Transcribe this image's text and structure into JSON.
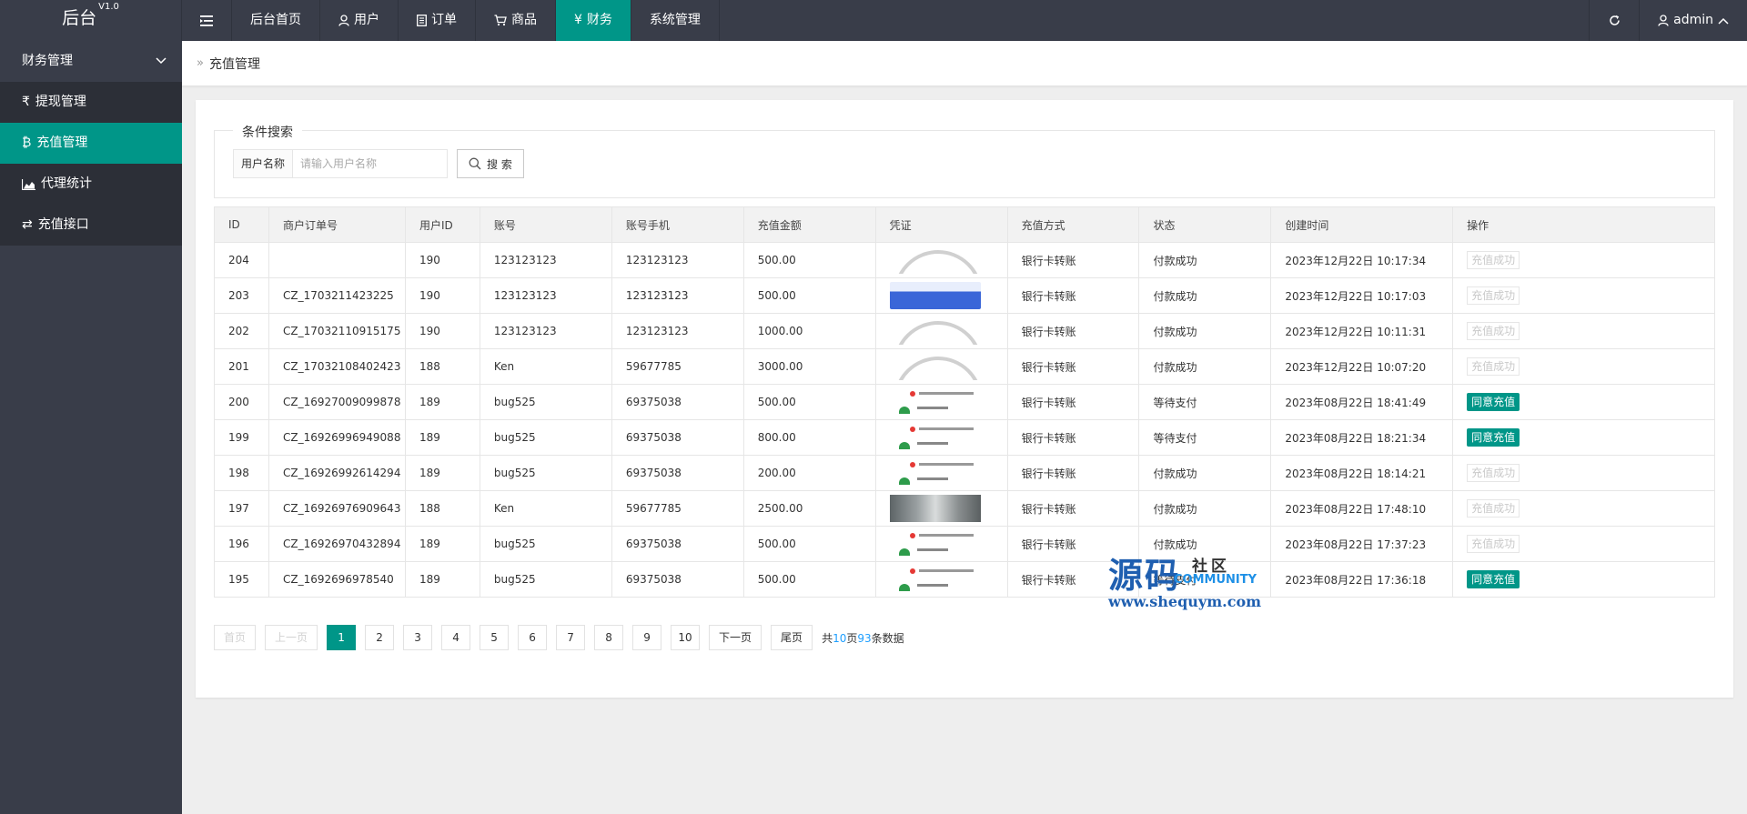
{
  "header": {
    "logo": "后台",
    "version": "V1.0",
    "nav": [
      {
        "label": "后台首页",
        "icon": ""
      },
      {
        "label": "用户",
        "icon": "user-icon"
      },
      {
        "label": "订单",
        "icon": "document-icon"
      },
      {
        "label": "商品",
        "icon": "cart-icon"
      },
      {
        "label": "财务",
        "icon": "yen-icon"
      },
      {
        "label": "系统管理",
        "icon": ""
      }
    ],
    "user": "admin"
  },
  "sidebar": {
    "group": "财务管理",
    "items": [
      {
        "label": "提现管理",
        "icon": "rupee-icon"
      },
      {
        "label": "充值管理",
        "icon": "bitcoin-icon"
      },
      {
        "label": "代理统计",
        "icon": "area-chart-icon"
      },
      {
        "label": "充值接口",
        "icon": "exchange-icon"
      }
    ]
  },
  "breadcrumb": "充值管理",
  "search": {
    "legend": "条件搜索",
    "label": "用户名称",
    "placeholder": "请输入用户名称",
    "button": "搜 索"
  },
  "table": {
    "headers": [
      "ID",
      "商户订单号",
      "用户ID",
      "账号",
      "账号手机",
      "充值金额",
      "凭证",
      "充值方式",
      "状态",
      "创建时间",
      "操作"
    ],
    "rows": [
      {
        "id": "204",
        "order": "",
        "uid": "190",
        "account": "123123123",
        "phone": "123123123",
        "amount": "500.00",
        "voucher": "arc",
        "method": "银行卡转账",
        "status": "付款成功",
        "status_type": "ok",
        "time": "2023年12月22日 10:17:34",
        "action": "充值成功",
        "action_type": "done"
      },
      {
        "id": "203",
        "order": "CZ_1703211423225",
        "uid": "190",
        "account": "123123123",
        "phone": "123123123",
        "amount": "500.00",
        "voucher": "blue",
        "method": "银行卡转账",
        "status": "付款成功",
        "status_type": "ok",
        "time": "2023年12月22日 10:17:03",
        "action": "充值成功",
        "action_type": "done"
      },
      {
        "id": "202",
        "order": "CZ_17032110915175",
        "uid": "190",
        "account": "123123123",
        "phone": "123123123",
        "amount": "1000.00",
        "voucher": "arc",
        "method": "银行卡转账",
        "status": "付款成功",
        "status_type": "ok",
        "time": "2023年12月22日 10:11:31",
        "action": "充值成功",
        "action_type": "done"
      },
      {
        "id": "201",
        "order": "CZ_17032108402423",
        "uid": "188",
        "account": "Ken",
        "phone": "59677785",
        "amount": "3000.00",
        "voucher": "arc",
        "method": "银行卡转账",
        "status": "付款成功",
        "status_type": "ok",
        "time": "2023年12月22日 10:07:20",
        "action": "充值成功",
        "action_type": "done"
      },
      {
        "id": "200",
        "order": "CZ_16927009099878",
        "uid": "189",
        "account": "bug525",
        "phone": "69375038",
        "amount": "500.00",
        "voucher": "text",
        "method": "银行卡转账",
        "status": "等待支付",
        "status_type": "wait",
        "time": "2023年08月22日 18:41:49",
        "action": "同意充值",
        "action_type": "agree"
      },
      {
        "id": "199",
        "order": "CZ_16926996949088",
        "uid": "189",
        "account": "bug525",
        "phone": "69375038",
        "amount": "800.00",
        "voucher": "text",
        "method": "银行卡转账",
        "status": "等待支付",
        "status_type": "wait",
        "time": "2023年08月22日 18:21:34",
        "action": "同意充值",
        "action_type": "agree"
      },
      {
        "id": "198",
        "order": "CZ_16926992614294",
        "uid": "189",
        "account": "bug525",
        "phone": "69375038",
        "amount": "200.00",
        "voucher": "text",
        "method": "银行卡转账",
        "status": "付款成功",
        "status_type": "ok",
        "time": "2023年08月22日 18:14:21",
        "action": "充值成功",
        "action_type": "done"
      },
      {
        "id": "197",
        "order": "CZ_16926976909643",
        "uid": "188",
        "account": "Ken",
        "phone": "59677785",
        "amount": "2500.00",
        "voucher": "phone",
        "method": "银行卡转账",
        "status": "付款成功",
        "status_type": "ok",
        "time": "2023年08月22日 17:48:10",
        "action": "充值成功",
        "action_type": "done"
      },
      {
        "id": "196",
        "order": "CZ_16926970432894",
        "uid": "189",
        "account": "bug525",
        "phone": "69375038",
        "amount": "500.00",
        "voucher": "text",
        "method": "银行卡转账",
        "status": "付款成功",
        "status_type": "ok",
        "time": "2023年08月22日 17:37:23",
        "action": "充值成功",
        "action_type": "done"
      },
      {
        "id": "195",
        "order": "CZ_1692696978540",
        "uid": "189",
        "account": "bug525",
        "phone": "69375038",
        "amount": "500.00",
        "voucher": "text",
        "method": "银行卡转账",
        "status": "等待支付",
        "status_type": "wait",
        "time": "2023年08月22日 17:36:18",
        "action": "同意充值",
        "action_type": "agree"
      }
    ]
  },
  "pager": {
    "first": "首页",
    "prev": "上一页",
    "pages": [
      "1",
      "2",
      "3",
      "4",
      "5",
      "6",
      "7",
      "8",
      "9",
      "10"
    ],
    "current": "1",
    "next": "下一页",
    "last": "尾页",
    "total_prefix": "共",
    "total_pages": "10",
    "pages_suffix": "页",
    "total_records": "93",
    "records_suffix": "条数据"
  },
  "watermark": {
    "big": "源码",
    "small": "社区",
    "community": "COMMUNITY",
    "url": "www.shequym.com"
  },
  "colors": {
    "header_bg": "#393d49",
    "accent": "#009688",
    "ok": "#009f2e",
    "wait": "#1e9fff"
  }
}
